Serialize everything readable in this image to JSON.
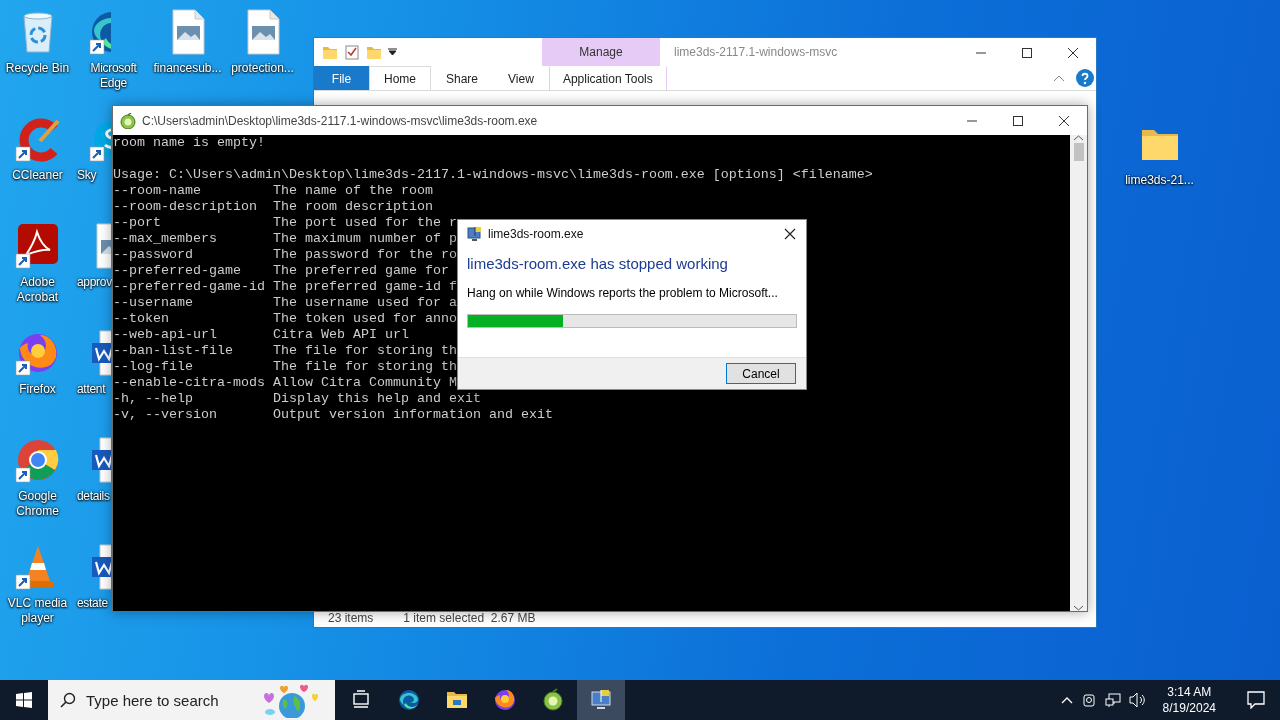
{
  "desktop_icons": [
    [
      {
        "label": "Recycle Bin",
        "kind": "bin",
        "shortcut": false
      },
      {
        "label": "CCleaner",
        "kind": "cleaner",
        "shortcut": true
      },
      {
        "label": "Adobe Acrobat",
        "kind": "pdf",
        "shortcut": true
      },
      {
        "label": "Firefox",
        "kind": "firefox",
        "shortcut": true
      },
      {
        "label": "Google Chrome",
        "kind": "chrome",
        "shortcut": true
      },
      {
        "label": "VLC media player",
        "kind": "vlc",
        "shortcut": true
      }
    ],
    [
      {
        "label": "Microsoft Edge",
        "kind": "edge",
        "shortcut": true
      },
      {
        "label": "Sky",
        "kind": "skype",
        "shortcut": true
      },
      {
        "label": "approv",
        "kind": "image",
        "shortcut": false
      },
      {
        "label": "attent",
        "kind": "word",
        "shortcut": false
      },
      {
        "label": "details",
        "kind": "word",
        "shortcut": false
      },
      {
        "label": "estate",
        "kind": "word",
        "shortcut": false
      }
    ],
    [
      {
        "label": "financesub...",
        "kind": "image",
        "shortcut": false
      }
    ],
    [
      {
        "label": "protection...",
        "kind": "image",
        "shortcut": false
      }
    ]
  ],
  "desktop_icons_right": [
    {
      "label": "lime3ds-21...",
      "kind": "folder",
      "shortcut": false
    }
  ],
  "explorer": {
    "title": "lime3ds-2117.1-windows-msvc",
    "context_group": "Manage",
    "tabs": [
      {
        "label": "File",
        "kind": "file",
        "selected": false
      },
      {
        "label": "Home",
        "kind": "tab",
        "selected": true
      },
      {
        "label": "Share",
        "kind": "tab",
        "selected": false
      },
      {
        "label": "View",
        "kind": "tab",
        "selected": false
      },
      {
        "label": "Application Tools",
        "kind": "context",
        "selected": false
      }
    ],
    "status_bar": {
      "item_count": "23 items",
      "selection": "1 item selected  2.67 MB"
    }
  },
  "console": {
    "title": "C:\\Users\\admin\\Desktop\\lime3ds-2117.1-windows-msvc\\lime3ds-room.exe",
    "message": "room name is empty!",
    "usage": "Usage: C:\\Users\\admin\\Desktop\\lime3ds-2117.1-windows-msvc\\lime3ds-room.exe [options] <filename>",
    "options": [
      {
        "flag": "--room-name",
        "description": "The name of the room"
      },
      {
        "flag": "--room-description",
        "description": "The room description"
      },
      {
        "flag": "--port",
        "description": "The port used for the r"
      },
      {
        "flag": "--max_members",
        "description": "The maximum number of p"
      },
      {
        "flag": "--password",
        "description": "The password for the ro"
      },
      {
        "flag": "--preferred-game",
        "description": "The preferred game for"
      },
      {
        "flag": "--preferred-game-id",
        "description": "The preferred game-id f"
      },
      {
        "flag": "--username",
        "description": "The username used for a"
      },
      {
        "flag": "--token",
        "description": "The token used for anno"
      },
      {
        "flag": "--web-api-url",
        "description": "Citra Web API url"
      },
      {
        "flag": "--ban-list-file",
        "description": "The file for storing th"
      },
      {
        "flag": "--log-file",
        "description": "The file for storing th"
      },
      {
        "flag": "--enable-citra-mods",
        "description": "Allow Citra Community M"
      },
      {
        "flag": "-h, --help",
        "description": "Display this help and exit"
      },
      {
        "flag": "-v, --version",
        "description": "Output version information and exit"
      }
    ]
  },
  "error_dialog": {
    "title": "lime3ds-room.exe",
    "heading": "lime3ds-room.exe has stopped working",
    "message": "Hang on while Windows reports the problem to Microsoft...",
    "progress": {
      "level": 0.29
    },
    "buttons": [
      "Cancel"
    ]
  },
  "taskbar": {
    "search": {
      "placeholder": "Type here to search"
    },
    "apps": [
      {
        "kind": "taskview",
        "selected": false
      },
      {
        "kind": "edge",
        "selected": false
      },
      {
        "kind": "explorer",
        "selected": false
      },
      {
        "kind": "firefox",
        "selected": false
      },
      {
        "kind": "lime",
        "selected": false
      },
      {
        "kind": "errorreport",
        "selected": true
      }
    ],
    "clock": {
      "time": "3:14 AM",
      "date": "8/19/2024"
    }
  }
}
